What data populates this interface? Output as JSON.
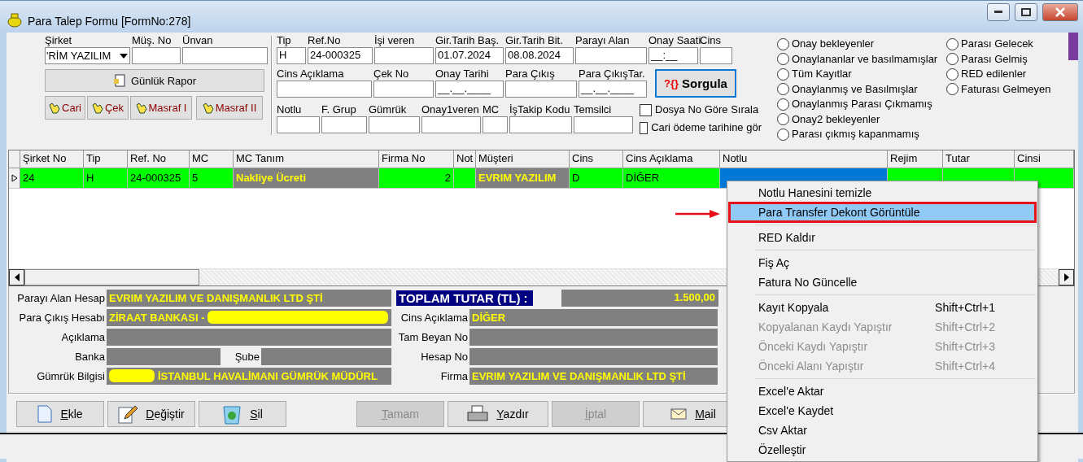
{
  "window": {
    "title": "Para Talep Formu [FormNo:278]"
  },
  "header_fields": [
    {
      "label": "Şirket",
      "value": "'RİM YAZILIM",
      "kind": "dropdown"
    },
    {
      "label": "Müş. No",
      "kind": "text"
    },
    {
      "label": "Ünvan",
      "kind": "text"
    }
  ],
  "report_button": "Günlük Rapor",
  "shortcut_buttons": [
    "Cari",
    "Çek",
    "Masraf I",
    "Masraf II"
  ],
  "filter_rows": [
    [
      {
        "label": "Tip",
        "value": "H"
      },
      {
        "label": "Ref.No",
        "value": "24-000325"
      },
      {
        "label": "İşi veren"
      },
      {
        "label": "Gir.Tarih Baş.",
        "value": "01.07.2024"
      },
      {
        "label": "Gir.Tarih Bit.",
        "value": "08.08.2024"
      },
      {
        "label": "Parayı Alan"
      },
      {
        "label": "Onay Saati",
        "value": "__:__"
      },
      {
        "label": "Cins"
      }
    ],
    [
      {
        "label": "Cins Açıklama"
      },
      {
        "label": "Çek No"
      },
      {
        "label": "Onay Tarihi",
        "value": "__.__.____"
      },
      {
        "label": "Para Çıkış"
      },
      {
        "label": "Para ÇıkışTar.",
        "value": "__.__.____"
      }
    ],
    [
      {
        "label": "Notlu"
      },
      {
        "label": "F. Grup"
      },
      {
        "label": "Gümrük"
      },
      {
        "label": "Onay1veren"
      },
      {
        "label": "MC"
      },
      {
        "label": "İşTakip Kodu"
      },
      {
        "label": "Temsilci"
      }
    ]
  ],
  "query_button": {
    "mark": "?{}",
    "label": "Sorgula"
  },
  "checkboxes": [
    {
      "label": "Dosya No Göre Sırala",
      "checked": false
    },
    {
      "label": "Cari ödeme tarihine gör",
      "checked": false
    }
  ],
  "radio_columns": [
    [
      {
        "label": "Onay bekleyenler",
        "selected": false
      },
      {
        "label": "Onaylananlar ve basılmamışlar",
        "selected": false
      },
      {
        "label": "Tüm Kayıtlar",
        "selected": false
      },
      {
        "label": "Onaylanmış ve Basılmışlar",
        "selected": false
      },
      {
        "label": "Onaylanmış Parası Çıkmamış",
        "selected": false
      },
      {
        "label": "Onay2 bekleyenler",
        "selected": false
      },
      {
        "label": "Parası çıkmış kapanmamış",
        "selected": false
      }
    ],
    [
      {
        "label": "Parası Gelecek",
        "selected": false
      },
      {
        "label": "Parası Gelmiş",
        "selected": false
      },
      {
        "label": "RED edilenler",
        "selected": false
      },
      {
        "label": "Faturası Gelmeyen",
        "selected": false
      }
    ]
  ],
  "table": {
    "columns": [
      "Şirket No",
      "Tip",
      "Ref. No",
      "MC",
      "MC Tanım",
      "Firma No",
      "Not",
      "Müşteri",
      "Cins",
      "Cins Açıklama",
      "Notlu",
      "Rejim",
      "Tutar",
      "Cinsi"
    ],
    "rows": [
      {
        "selected": true,
        "cells": [
          {
            "text": "24",
            "kind": "plain"
          },
          {
            "text": "H",
            "kind": "plain"
          },
          {
            "text": "24-000325",
            "kind": "plain"
          },
          {
            "text": "5",
            "kind": "plain"
          },
          {
            "text": "Nakliye Ücreti",
            "kind": "highlight"
          },
          {
            "text": "2",
            "kind": "number"
          },
          {
            "kind": "plain"
          },
          {
            "text": "EVRIM YAZILIM",
            "kind": "highlight"
          },
          {
            "text": "D",
            "kind": "plain"
          },
          {
            "text": "DİĞER",
            "kind": "plain"
          },
          {
            "kind": "focus"
          }
        ]
      }
    ]
  },
  "details": [
    {
      "left": [
        {
          "label": "Parayı Alan Hesap",
          "value": "EVRIM YAZILIM VE DANIŞMANLIK LTD ŞTİ"
        }
      ],
      "right": {
        "label": "TOPLAM TUTAR (TL) :",
        "value": "1.500,00",
        "kind": "total"
      }
    },
    {
      "left": [
        {
          "label": "Para Çıkış Hesabı",
          "value": "ZİRAAT BANKASI -",
          "redacted_after": true
        }
      ],
      "right": {
        "label": "Cins Açıklama",
        "value": "DİĞER",
        "kind": "plain"
      }
    },
    {
      "left": [
        {
          "label": "Açıklama"
        }
      ],
      "right": {
        "label": "Tam Beyan No",
        "kind": "plain"
      }
    },
    {
      "left": [
        {
          "label": "Banka"
        },
        {
          "label": "Şube"
        }
      ],
      "right": {
        "label": "Hesap No",
        "kind": "plain"
      }
    },
    {
      "left": [
        {
          "label": "Gümrük Bilgisi",
          "value": "İSTANBUL HAVALİMANI GÜMRÜK MÜDÜRL",
          "redacted_before": true
        }
      ],
      "right": {
        "label": "Firma",
        "value": "EVRIM YAZILIM VE DANIŞMANLIK LTD ŞTİ",
        "kind": "plain"
      }
    }
  ],
  "actions": [
    {
      "label": "Ekle",
      "disabled": false
    },
    {
      "label": "Değiştir",
      "disabled": false
    },
    {
      "label": "Sil",
      "disabled": false
    },
    {
      "label": "Tamam",
      "disabled": true
    },
    {
      "label": "Yazdır",
      "disabled": false
    },
    {
      "label": "İptal",
      "disabled": true
    },
    {
      "label": "Mail",
      "disabled": false
    }
  ],
  "context_menu": [
    {
      "kind": "item",
      "label": "Notlu Hanesini temizle",
      "selected": false,
      "disabled": false
    },
    {
      "kind": "item",
      "label": "Para Transfer Dekont Görüntüle",
      "selected": true,
      "disabled": false
    },
    {
      "kind": "separator"
    },
    {
      "kind": "item",
      "label": "RED Kaldır",
      "selected": false,
      "disabled": false
    },
    {
      "kind": "separator"
    },
    {
      "kind": "item",
      "label": "Fiş Aç",
      "selected": false,
      "disabled": false
    },
    {
      "kind": "item",
      "label": "Fatura No Güncelle",
      "selected": false,
      "disabled": false
    },
    {
      "kind": "separator"
    },
    {
      "kind": "item",
      "label": "Kayıt Kopyala",
      "shortcut": "Shift+Ctrl+1",
      "selected": false,
      "disabled": false
    },
    {
      "kind": "item",
      "label": "Kopyalanan Kaydı Yapıştır",
      "shortcut": "Shift+Ctrl+2",
      "selected": false,
      "disabled": true
    },
    {
      "kind": "item",
      "label": "Önceki Kaydı Yapıştır",
      "shortcut": "Shift+Ctrl+3",
      "selected": false,
      "disabled": true
    },
    {
      "kind": "item",
      "label": "Önceki Alanı Yapıştır",
      "shortcut": "Shift+Ctrl+4",
      "selected": false,
      "disabled": true
    },
    {
      "kind": "separator"
    },
    {
      "kind": "item",
      "label": "Excel'e Aktar",
      "selected": false,
      "disabled": false
    },
    {
      "kind": "item",
      "label": "Excel'e Kaydet",
      "selected": false,
      "disabled": false
    },
    {
      "kind": "item",
      "label": "Csv Aktar",
      "selected": false,
      "disabled": false
    },
    {
      "kind": "item",
      "label": "Özelleştir",
      "selected": false,
      "disabled": false
    }
  ]
}
